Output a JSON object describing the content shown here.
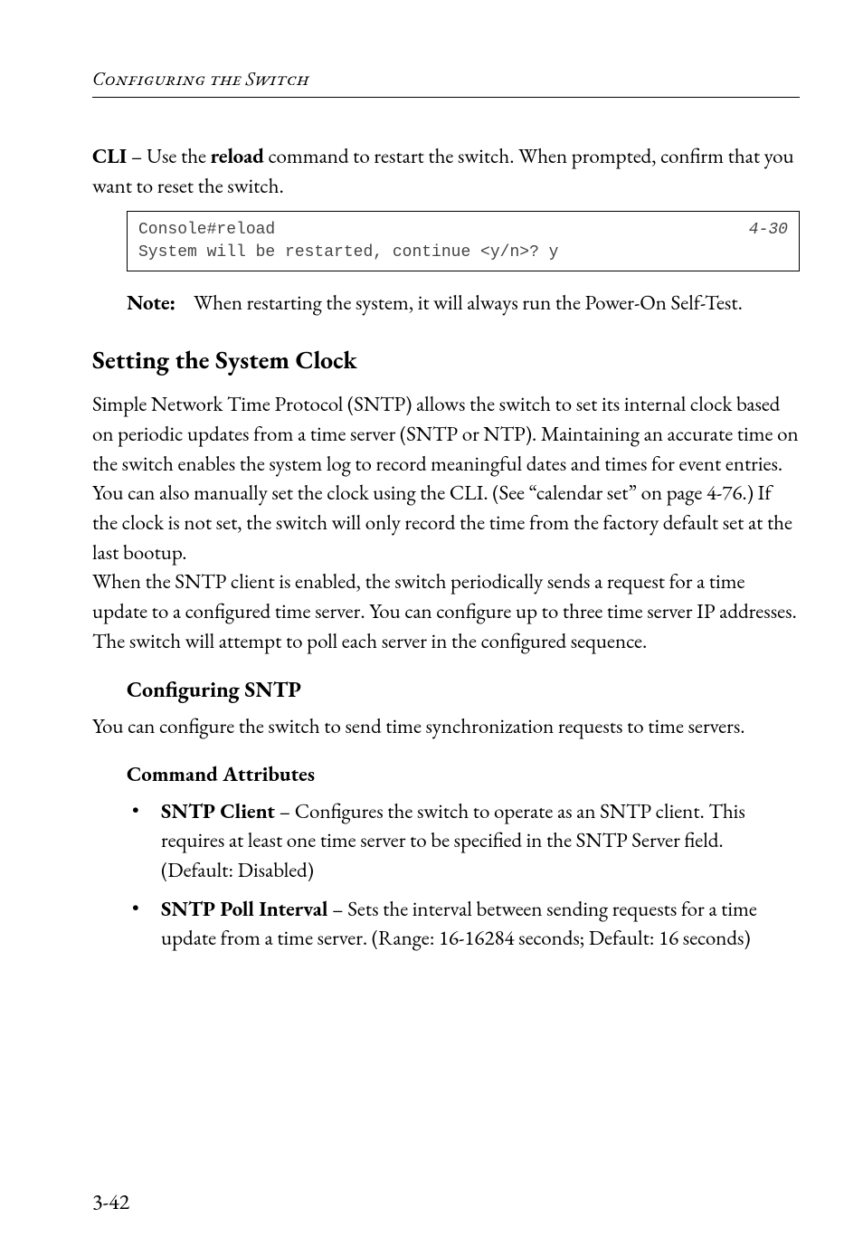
{
  "header": {
    "running_head": "Configuring the Switch"
  },
  "intro": {
    "cli_para_prefix": "CLI",
    "cli_para_middle": " – Use the ",
    "cli_para_reload": "reload",
    "cli_para_suffix": " command to restart the switch. When prompted, confirm that you want to reset the switch."
  },
  "code": {
    "line1": "Console#reload",
    "line2": "System will be restarted, continue <y/n>? y",
    "ref": "4-30"
  },
  "note": {
    "label": "Note:",
    "text": "When restarting the system, it will always run the Power-On Self-Test."
  },
  "section": {
    "h2": "Setting the System Clock",
    "p1": "Simple Network Time Protocol (SNTP) allows the switch to set its internal clock based on periodic updates from a time server (SNTP or NTP). Maintaining an accurate time on the switch enables the system log to record meaningful dates and times for event entries. You can also manually set the clock using the CLI. (See “calendar set” on page 4-76.) If the clock is not set, the switch will only record the time from the factory default set at the last bootup.",
    "p2": "When the SNTP client is enabled, the switch periodically sends a request for a time update to a configured time server. You can configure up to three time server IP addresses. The switch will attempt to poll each server in the configured sequence.",
    "h3": "Configuring SNTP",
    "p3": "You can configure the switch to send time synchronization requests to time servers.",
    "h4": "Command Attributes",
    "bullets": [
      {
        "term": "SNTP Client",
        "desc": " – Configures the switch to operate as an SNTP client. This requires at least one time server to be specified in the SNTP Server field. (Default: Disabled)"
      },
      {
        "term": "SNTP Poll Interval",
        "desc": " – Sets the interval between sending requests for a time update from a time server. (Range: 16-16284 seconds; Default: 16 seconds)"
      }
    ]
  },
  "footer": {
    "page": "3-42"
  }
}
